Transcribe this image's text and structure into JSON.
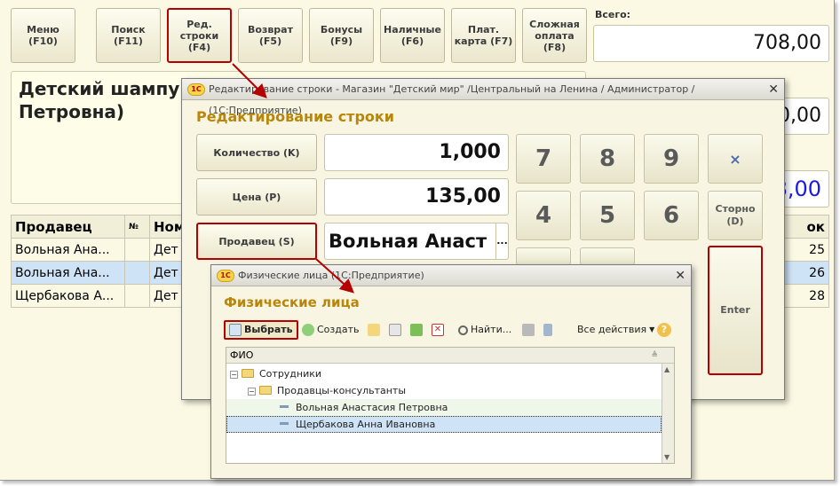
{
  "toolbar": [
    {
      "label": "Меню (F10)"
    },
    {
      "label": "Поиск\n(F11)"
    },
    {
      "label": "Ред.\nстроки (F4)"
    },
    {
      "label": "Возврат\n(F5)"
    },
    {
      "label": "Бонусы\n(F9)"
    },
    {
      "label": "Наличные\n(F6)"
    },
    {
      "label": "Плат.\nкарта (F7)"
    },
    {
      "label": "Сложная\nоплата (F8)"
    }
  ],
  "total": {
    "label": "Всего:",
    "value": "708,00"
  },
  "right_partial_values": {
    "value2": "0,00",
    "value3": "8,00"
  },
  "product": {
    "name": "Детский шампун\nПетровна)"
  },
  "table": {
    "headers": [
      "Продавец",
      "№",
      "Ном",
      "ок"
    ],
    "rows": [
      {
        "seller": "Вольная Ана...",
        "num": "",
        "nom": "Дет",
        "qty": "25"
      },
      {
        "seller": "Вольная Ана...",
        "num": "",
        "nom": "Дет",
        "qty": "26"
      },
      {
        "seller": "Щербакова А...",
        "num": "",
        "nom": "Дет",
        "qty": "28"
      }
    ]
  },
  "dialog1": {
    "window_title": "Редактирование строки - Магазин \"Детский мир\" /Центральный на Ленина / Администратор /  (1С:Предприятие)",
    "heading": "Редактирование строки",
    "quantity_label": "Количество (K)",
    "quantity_value": "1,000",
    "price_label": "Цена (P)",
    "price_value": "135,00",
    "seller_label": "Продавец (S)",
    "seller_value": "Вольная Анаст",
    "seller_ellipsis": "...",
    "keys": [
      "7",
      "8",
      "9",
      "×",
      "4",
      "5",
      "6",
      "Сторно\n(D)",
      "Enter"
    ]
  },
  "dialog2": {
    "window_title": "Физические лица  (1С:Предприятие)",
    "heading": "Физические лица",
    "toolbar": {
      "select": "Выбрать",
      "create": "Создать",
      "find": "Найти...",
      "all_actions": "Все действия"
    },
    "column": "ФИО",
    "tree": [
      {
        "label": "Сотрудники"
      },
      {
        "label": "Продавцы-консультанты"
      },
      {
        "label": "Вольная Анастасия Петровна"
      },
      {
        "label": "Щербакова Анна Ивановна"
      }
    ]
  },
  "colors": {
    "highlight": "#b40000",
    "heading": "#b7860b",
    "selection": "#cfe3f7",
    "total_blue": "#1a1ae6"
  }
}
